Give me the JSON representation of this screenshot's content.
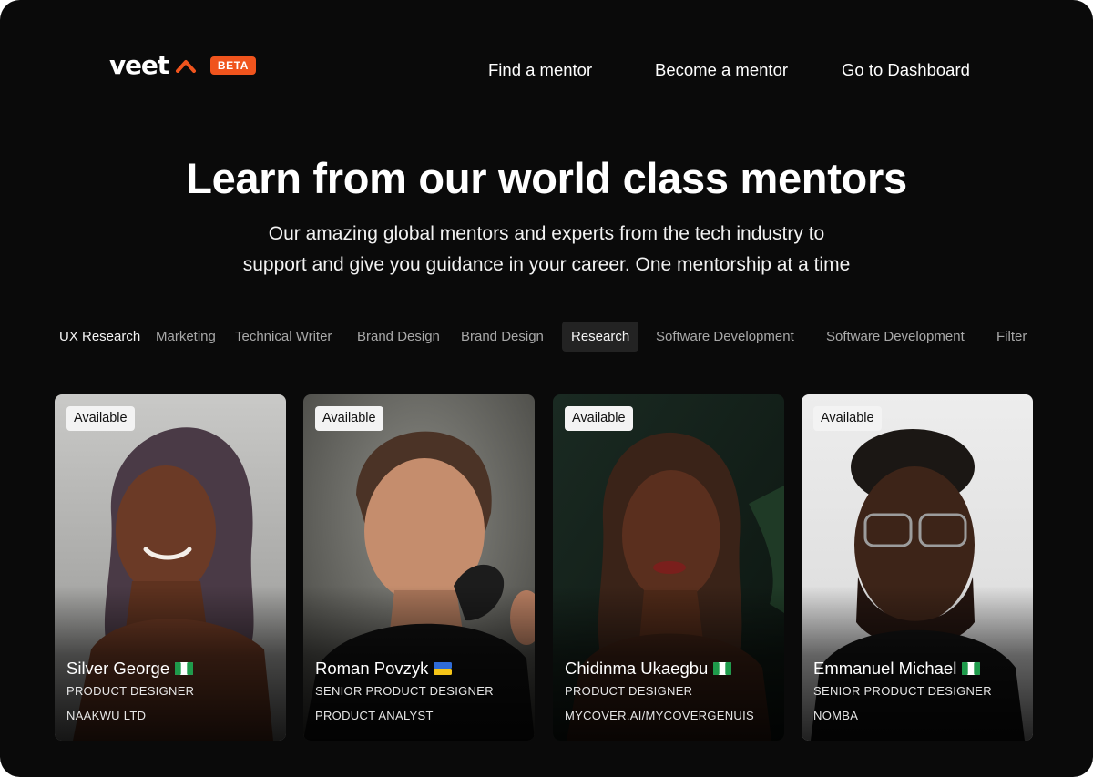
{
  "brand": {
    "name": "veet",
    "badge": "BETA",
    "accent": "#f0541d",
    "icon": "caret-up-icon"
  },
  "nav": {
    "items": [
      "Find a mentor",
      "Become a mentor",
      "Go to Dashboard"
    ]
  },
  "hero": {
    "title": "Learn from our world class mentors",
    "subtitle_line1": "Our amazing global mentors and experts from the tech industry to",
    "subtitle_line2": "support and give you guidance in your career. One mentorship at a time"
  },
  "filters": {
    "items": [
      "UX Research",
      "Marketing",
      "Technical Writer",
      "Brand Design",
      "Brand Design",
      "Research",
      "Software Development",
      "Software Development",
      "Filter"
    ],
    "selected": "Research"
  },
  "mentors": [
    {
      "status": "Available",
      "name": "Silver George",
      "flag": "nigeria-flag-icon",
      "role": "PRODUCT DESIGNER",
      "company": "NAAKWU LTD"
    },
    {
      "status": "Available",
      "name": "Roman Povzyk",
      "flag": "ukraine-flag-icon",
      "role": "SENIOR PRODUCT DESIGNER",
      "company": "PRODUCT ANALYST"
    },
    {
      "status": "Available",
      "name": "Chidinma Ukaegbu",
      "flag": "nigeria-flag-icon",
      "role": "PRODUCT DESIGNER",
      "company": "MYCOVER.AI/MYCOVERGENUIS"
    },
    {
      "status": "Available",
      "name": "Emmanuel Michael",
      "flag": "nigeria-flag-icon",
      "role": "SENIOR PRODUCT DESIGNER",
      "company": "NOMBA"
    }
  ],
  "colors": {
    "background": "#0a0a0a",
    "accent": "#f0541d",
    "tab_active_bg": "#232323",
    "badge_bg": "#f3f3f3"
  }
}
